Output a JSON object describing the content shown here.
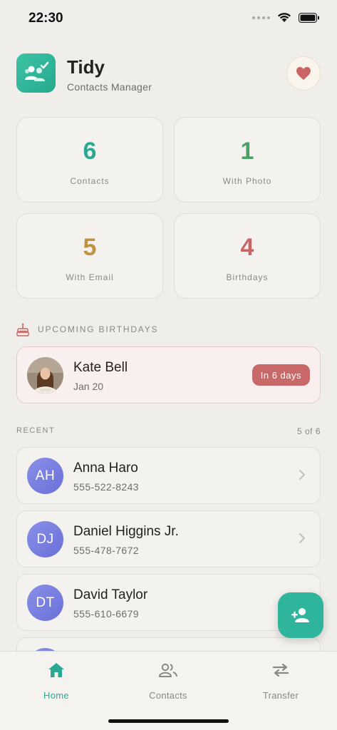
{
  "status_bar": {
    "time": "22:30"
  },
  "app": {
    "title": "Tidy",
    "subtitle": "Contacts Manager"
  },
  "stats": [
    {
      "value": "6",
      "label": "Contacts",
      "color": "#2aa892"
    },
    {
      "value": "1",
      "label": "With Photo",
      "color": "#4aa266"
    },
    {
      "value": "5",
      "label": "With Email",
      "color": "#c3923f"
    },
    {
      "value": "4",
      "label": "Birthdays",
      "color": "#c96464"
    }
  ],
  "birthdays": {
    "section_title": "UPCOMING BIRTHDAYS",
    "item": {
      "name": "Kate Bell",
      "date": "Jan 20",
      "badge": "In 6 days"
    }
  },
  "recent": {
    "title": "RECENT",
    "count": "5 of 6",
    "contacts": [
      {
        "initials": "AH",
        "name": "Anna Haro",
        "phone": "555-522-8243"
      },
      {
        "initials": "DJ",
        "name": "Daniel Higgins Jr.",
        "phone": "555-478-7672"
      },
      {
        "initials": "DT",
        "name": "David Taylor",
        "phone": "555-610-6679"
      }
    ]
  },
  "tabs": [
    {
      "label": "Home",
      "icon": "home-icon",
      "active": true
    },
    {
      "label": "Contacts",
      "icon": "contacts-icon",
      "active": false
    },
    {
      "label": "Transfer",
      "icon": "transfer-icon",
      "active": false
    }
  ],
  "colors": {
    "accent": "#2fb59b",
    "active_tab": "#2aa892",
    "inactive_tab": "#8a8883"
  }
}
